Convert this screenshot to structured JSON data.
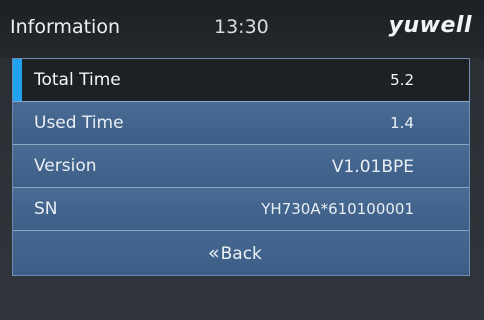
{
  "header": {
    "title": "Information",
    "time": "13:30",
    "brand": "yuwell"
  },
  "rows": [
    {
      "label": "Total Time",
      "value": "5.2",
      "selected": true
    },
    {
      "label": "Used Time",
      "value": "1.4"
    },
    {
      "label": "Version",
      "value": "V1.01BPE"
    },
    {
      "label": "SN",
      "value": "YH730A*610100001"
    }
  ],
  "back": {
    "icon": "double-chevron-left-icon",
    "label": "Back"
  },
  "colors": {
    "accent": "#1fa3ee",
    "row_bg": "#426489",
    "selected_bg": "#1d2125",
    "header_bg": "#1f2327"
  }
}
